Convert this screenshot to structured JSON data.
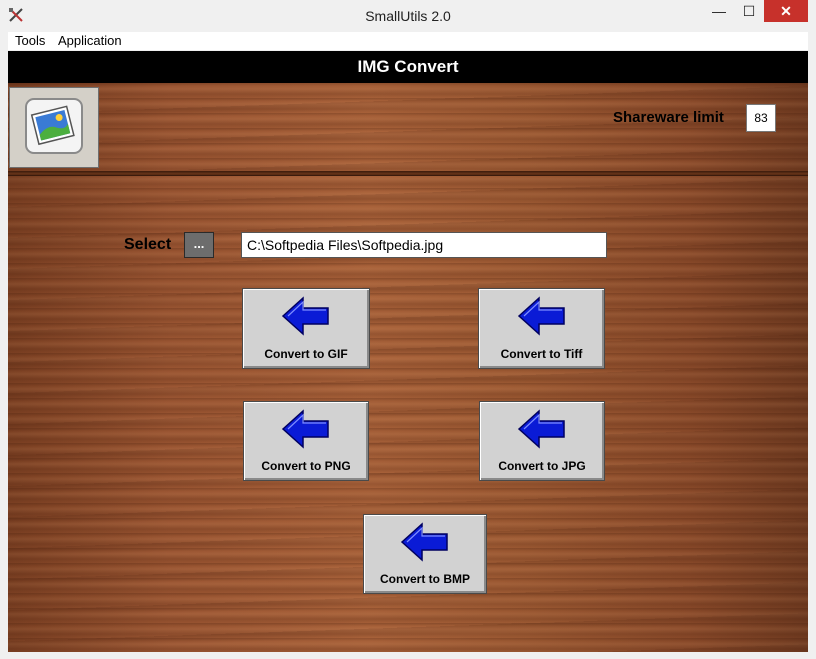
{
  "window": {
    "title": "SmallUtils 2.0",
    "minimize": "—",
    "maximize": "☐",
    "close": "✕"
  },
  "menu": [
    "Tools",
    "Application"
  ],
  "header": {
    "title": "IMG Convert"
  },
  "shareware": {
    "label": "Shareware limit",
    "count": "83"
  },
  "select": {
    "label": "Select",
    "browse": "...",
    "path": "C:\\Softpedia Files\\Softpedia.jpg"
  },
  "buttons": {
    "gif": "Convert to GIF",
    "tiff": "Convert to Tiff",
    "png": "Convert to PNG",
    "jpg": "Convert to JPG",
    "bmp": "Convert to BMP"
  },
  "icons": {
    "arrow": "left-arrow-icon",
    "logo": "image-icon"
  },
  "colors": {
    "arrow": "#0a1bd6",
    "header": "#000000",
    "close": "#c7312b"
  }
}
